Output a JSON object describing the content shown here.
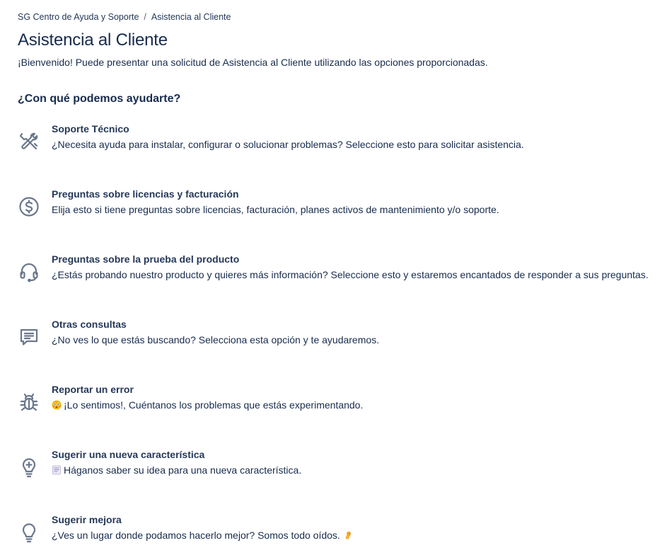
{
  "breadcrumb": {
    "home": "SG Centro de Ayuda y Soporte",
    "separator": "/",
    "current": "Asistencia al Cliente"
  },
  "page": {
    "title": "Asistencia al Cliente",
    "intro": "¡Bienvenido! Puede presentar una solicitud de Asistencia al Cliente utilizando las opciones proporcionadas."
  },
  "section": {
    "title": "¿Con qué podemos ayudarte?"
  },
  "options": [
    {
      "title": "Soporte Técnico",
      "description": "¿Necesita ayuda para instalar, configurar o solucionar problemas? Seleccione esto para solicitar asistencia.",
      "icon": "tools-icon"
    },
    {
      "title": "Preguntas sobre licencias y facturación",
      "description": "Elija esto si tiene preguntas sobre licencias, facturación, planes activos de mantenimiento y/o soporte.",
      "icon": "dollar-circle-icon"
    },
    {
      "title": "Preguntas sobre la prueba del producto",
      "description": "¿Estás probando nuestro producto y quieres más información? Seleccione esto y estaremos encantados de responder a sus preguntas.",
      "icon": "headset-icon"
    },
    {
      "title": "Otras consultas",
      "description": "¿No ves lo que estás buscando? Selecciona esta opción y te ayudaremos.",
      "icon": "chat-icon"
    },
    {
      "title": "Reportar un error",
      "description": "¡Lo sentimos!, Cuéntanos los problemas que estás experimentando.",
      "icon": "bug-icon",
      "emoji": "flushed-face-emoji"
    },
    {
      "title": "Sugerir una nueva característica",
      "description": "Háganos saber su idea para una nueva característica.",
      "icon": "lightbulb-plus-icon",
      "emoji": "notepad-emoji"
    },
    {
      "title": "Sugerir mejora",
      "description": "¿Ves un lugar donde podamos hacerlo mejor? Somos todo oídos.",
      "icon": "lightbulb-icon",
      "emoji": "ear-emoji"
    }
  ],
  "colors": {
    "text": "#172b4d",
    "link": "#253858",
    "icon": "#6b778c"
  }
}
